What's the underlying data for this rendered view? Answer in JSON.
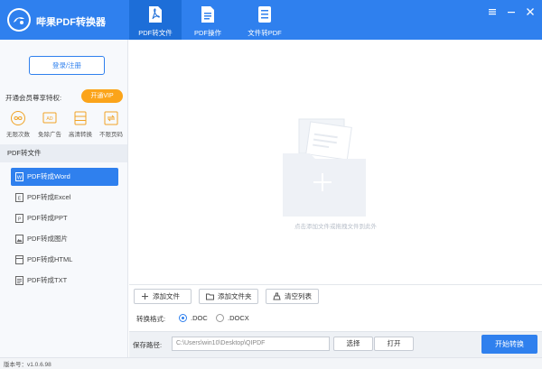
{
  "app": {
    "title": "哔果PDF转换器",
    "version_text": "版本号：v1.0.6.98"
  },
  "colors": {
    "brand": "#2f80ee",
    "brand_dark": "#1d6ed8",
    "vip": "#fba41a"
  },
  "top_tabs": [
    {
      "label": "PDF转文件",
      "icon": "pdf-file-icon",
      "active": true
    },
    {
      "label": "PDF操作",
      "icon": "pdf-operate-icon",
      "active": false
    },
    {
      "label": "文件转PDF",
      "icon": "file-to-pdf-icon",
      "active": false
    }
  ],
  "window_controls": [
    "menu-icon",
    "minimize-icon",
    "close-icon"
  ],
  "sidebar": {
    "login_label": "登录/注册",
    "vip_title": "开通会员尊享特权:",
    "vip_button": "开通VIP",
    "perks": [
      {
        "label": "无限次数",
        "icon": "infinity-icon"
      },
      {
        "label": "免除广告",
        "icon": "no-ad-icon"
      },
      {
        "label": "高清转换",
        "icon": "hd-convert-icon"
      },
      {
        "label": "不限页码",
        "icon": "unlimited-pages-icon"
      }
    ],
    "section_title": "PDF转文件",
    "items": [
      {
        "label": "PDF转成Word",
        "icon": "word-icon",
        "active": true
      },
      {
        "label": "PDF转成Excel",
        "icon": "excel-icon",
        "active": false
      },
      {
        "label": "PDF转成PPT",
        "icon": "ppt-icon",
        "active": false
      },
      {
        "label": "PDF转成图片",
        "icon": "image-icon",
        "active": false
      },
      {
        "label": "PDF转成HTML",
        "icon": "html-icon",
        "active": false
      },
      {
        "label": "PDF转成TXT",
        "icon": "txt-icon",
        "active": false
      }
    ]
  },
  "main": {
    "drop_hint": "点击添加文件或拖拽文件到此外",
    "toolbar": {
      "add_file": "添加文件",
      "add_folder": "添加文件夹",
      "clear_list": "清空列表"
    },
    "format": {
      "label": "转换格式:",
      "options": [
        ".DOC",
        ".DOCX"
      ],
      "selected": ".DOC"
    },
    "save": {
      "label": "保存路径:",
      "path": "C:\\Users\\win10\\Desktop\\QIPDF",
      "choose": "选择",
      "open": "打开",
      "start": "开始转换"
    }
  }
}
